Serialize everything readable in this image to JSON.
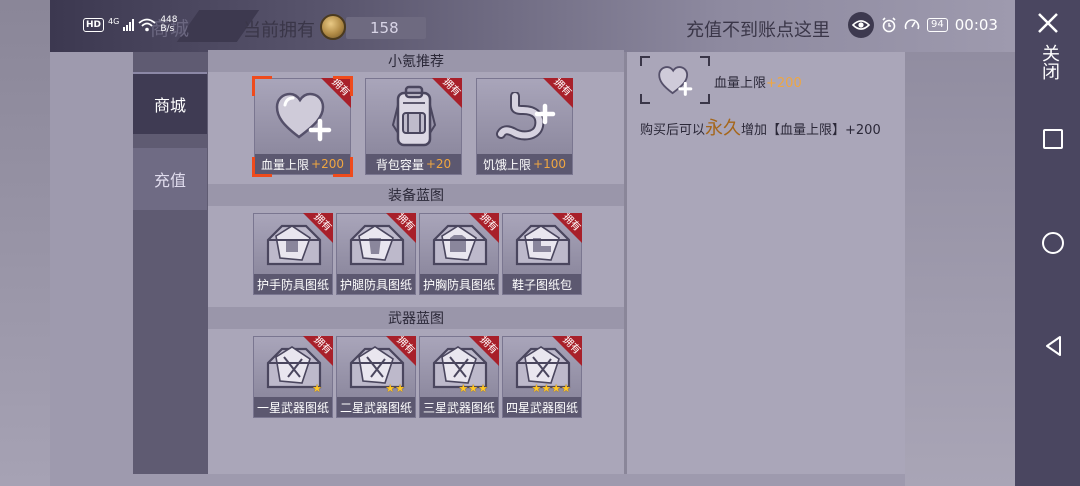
{
  "header": {
    "tab_title": "商城",
    "owned_label": "当前拥有",
    "coin_value": "158",
    "recharge_tip": "充值不到账点这里"
  },
  "status_bar": {
    "network": "4G",
    "hd": "HD",
    "speed_value": "448",
    "speed_unit": "B/s",
    "battery": "94",
    "clock": "00:03"
  },
  "nav_panel": {
    "close_label": "关闭"
  },
  "sidebar": {
    "items": [
      {
        "label": "商城",
        "active": true
      },
      {
        "label": "充值",
        "active": false
      }
    ]
  },
  "sections": [
    {
      "title": "小氪推荐",
      "items": [
        {
          "name": "血量上限",
          "bonus": "+200",
          "owned_tag": "拥有",
          "icon": "heart-plus-icon",
          "selected": true
        },
        {
          "name": "背包容量",
          "bonus": "+20",
          "owned_tag": "拥有",
          "icon": "backpack-icon",
          "selected": false
        },
        {
          "name": "饥饿上限",
          "bonus": "+100",
          "owned_tag": "拥有",
          "icon": "stomach-plus-icon",
          "selected": false
        }
      ]
    },
    {
      "title": "装备蓝图",
      "items": [
        {
          "name": "护手防具图纸",
          "owned_tag": "拥有",
          "icon": "glove-blueprint-icon"
        },
        {
          "name": "护腿防具图纸",
          "owned_tag": "拥有",
          "icon": "leg-armor-blueprint-icon"
        },
        {
          "name": "护胸防具图纸",
          "owned_tag": "拥有",
          "icon": "chest-armor-blueprint-icon"
        },
        {
          "name": "鞋子图纸包",
          "owned_tag": "拥有",
          "icon": "shoe-blueprint-icon"
        }
      ]
    },
    {
      "title": "武器蓝图",
      "items": [
        {
          "name": "一星武器图纸",
          "owned_tag": "拥有",
          "icon": "weapon-blueprint-icon",
          "stars": 1
        },
        {
          "name": "二星武器图纸",
          "owned_tag": "拥有",
          "icon": "weapon-blueprint-icon",
          "stars": 2
        },
        {
          "name": "三星武器图纸",
          "owned_tag": "拥有",
          "icon": "weapon-blueprint-icon",
          "stars": 3
        },
        {
          "name": "四星武器图纸",
          "owned_tag": "拥有",
          "icon": "weapon-blueprint-icon",
          "stars": 4
        }
      ]
    }
  ],
  "detail": {
    "icon": "heart-plus-icon",
    "name": "血量上限",
    "bonus": "+200",
    "desc_prefix": "购买后可以",
    "desc_emphasis": "永久",
    "desc_suffix": "增加【血量上限】+200"
  },
  "colors": {
    "selected_frame": "#ef4b1c",
    "owned_ribbon": "#a8202a",
    "bonus_text": "#f0a640",
    "emphasis_text": "#a5661a",
    "star": "#ffc726"
  }
}
